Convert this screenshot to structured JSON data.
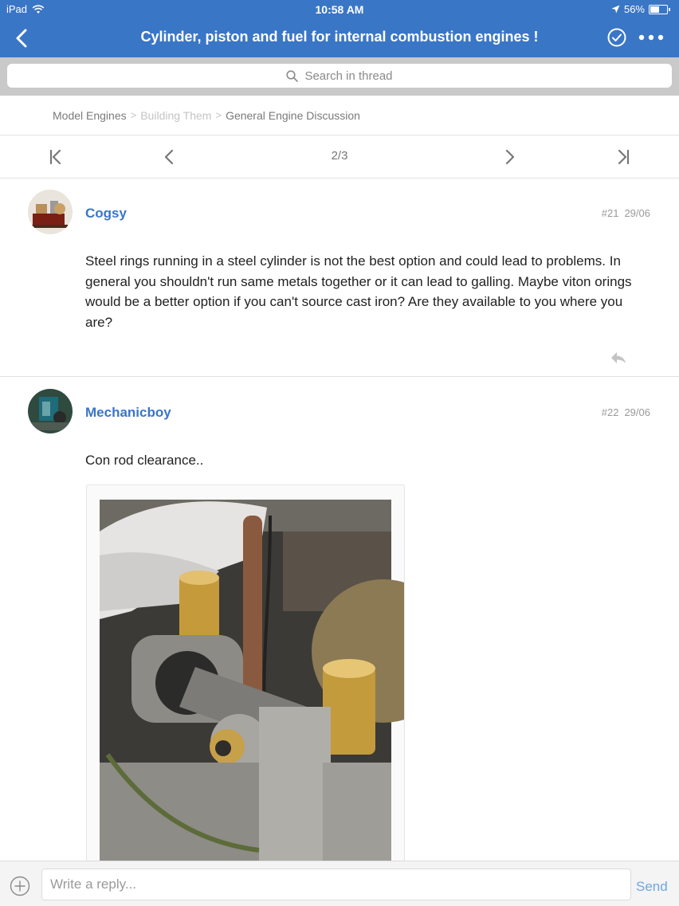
{
  "status": {
    "device": "iPad",
    "time": "10:58 AM",
    "battery": "56%",
    "battery_level": 0.56
  },
  "nav": {
    "title": "Cylinder, piston and fuel for  internal combustion engines !"
  },
  "search": {
    "placeholder": "Search in thread"
  },
  "breadcrumb": [
    "Model Engines",
    "Building Them",
    "General Engine Discussion"
  ],
  "pager": {
    "page": "2/3"
  },
  "posts": [
    {
      "author": "Cogsy",
      "number": "#21",
      "date": "29/06",
      "text": "Steel rings running in a steel cylinder is not the best option and could lead to problems. In general you shouldn't run same metals together or it can lead to galling. Maybe viton orings would be a better option if you can't source cast iron? Are they available to you where you are?"
    },
    {
      "author": "Mechanicboy",
      "number": "#22",
      "date": "29/06",
      "text": "Con rod clearance.."
    }
  ],
  "reply": {
    "placeholder": "Write a reply...",
    "send_label": "Send"
  },
  "colors": {
    "header": "#3a76c6",
    "author": "#3a76c6",
    "send": "#6da7e0"
  }
}
